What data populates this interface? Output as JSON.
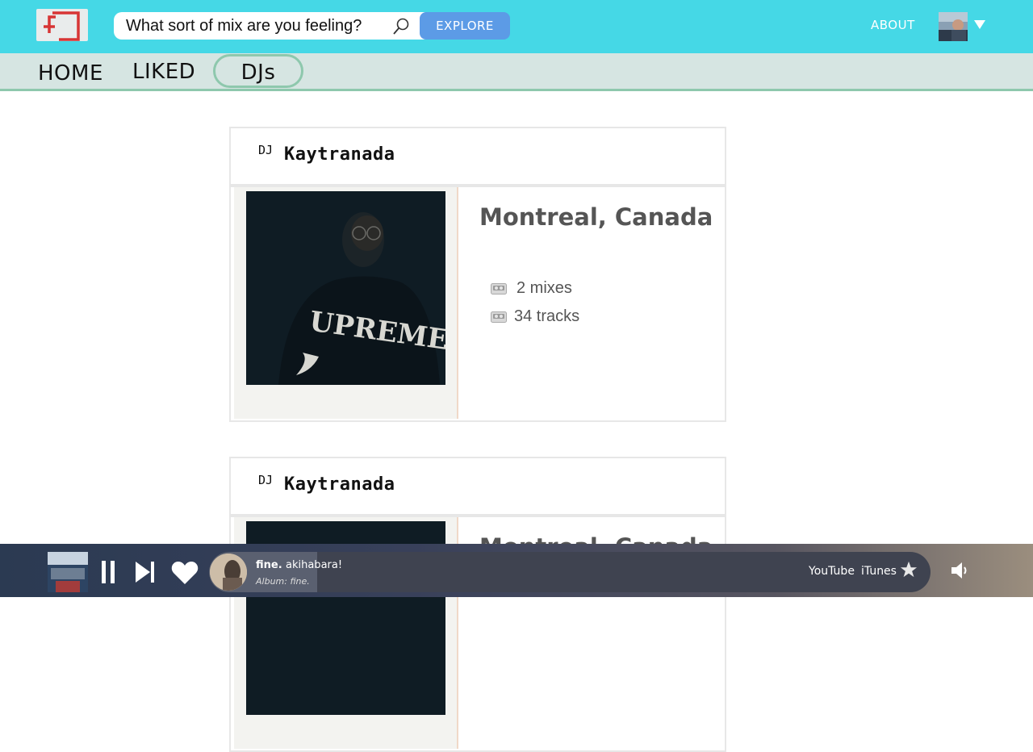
{
  "header": {
    "search_placeholder": "What sort of mix are you feeling?",
    "explore_label": "EXPLORE",
    "about_label": "ABOUT"
  },
  "nav": {
    "home": "HOME",
    "liked": "LIKED",
    "djs": "DJs",
    "active": "DJs"
  },
  "djs": [
    {
      "tag": "DJ",
      "name": "Kaytranada",
      "location": "Montreal, Canada",
      "mixes": "2 mixes",
      "tracks": "34 tracks",
      "shirt_text": "UPREME"
    },
    {
      "tag": "DJ",
      "name": "Kaytranada",
      "location": "Montreal, Canada"
    }
  ],
  "player": {
    "title": "fine.",
    "artist": "akihabara!",
    "album": "Album: fine.",
    "youtube": "YouTube",
    "itunes": "iTunes",
    "progress": 0.15,
    "state": "playing"
  },
  "colors": {
    "header_bg": "#45d8e6",
    "explore_btn": "#5c9be6",
    "nav_bg": "#d6e5e2",
    "nav_accent": "#8ec8ad"
  }
}
